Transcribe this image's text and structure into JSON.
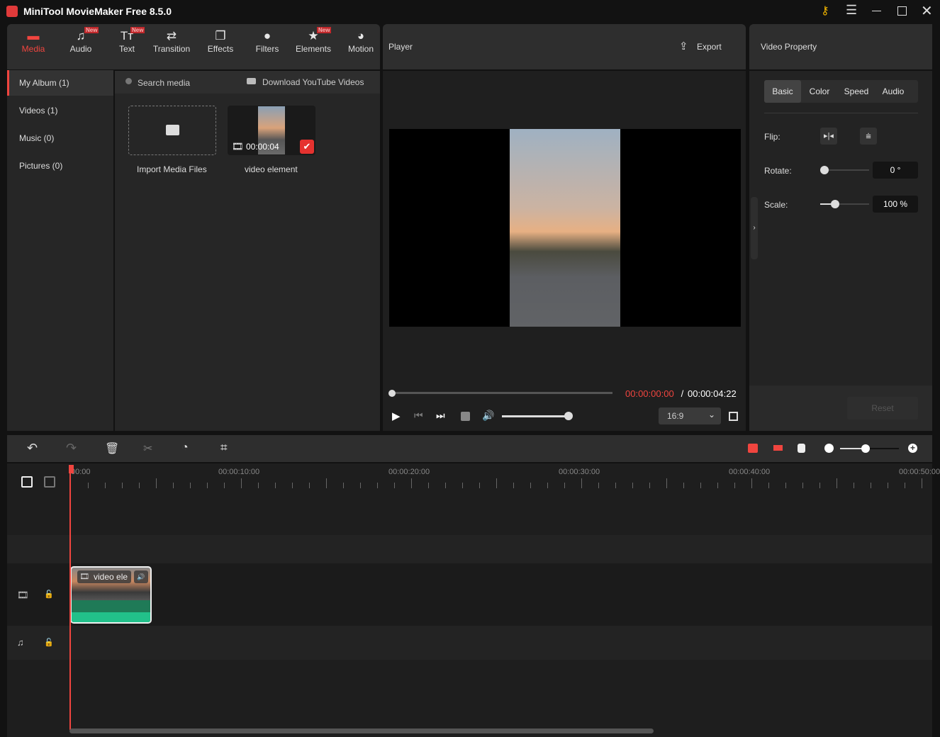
{
  "app": {
    "title": "MiniTool MovieMaker Free 8.5.0"
  },
  "toolbar": {
    "items": [
      {
        "label": "Media",
        "icon": "folder-icon",
        "new": false
      },
      {
        "label": "Audio",
        "icon": "music-icon",
        "new": true
      },
      {
        "label": "Text",
        "icon": "text-icon",
        "new": true
      },
      {
        "label": "Transition",
        "icon": "transition-icon",
        "new": false
      },
      {
        "label": "Effects",
        "icon": "effects-icon",
        "new": false
      },
      {
        "label": "Filters",
        "icon": "filters-icon",
        "new": false
      },
      {
        "label": "Elements",
        "icon": "elements-icon",
        "new": true
      },
      {
        "label": "Motion",
        "icon": "motion-icon",
        "new": false
      }
    ],
    "new_badge": "New"
  },
  "sidebar": {
    "items": [
      "My Album (1)",
      "Videos (1)",
      "Music (0)",
      "Pictures (0)"
    ]
  },
  "media": {
    "search_placeholder": "Search media",
    "download_label": "Download YouTube Videos",
    "import_label": "Import Media Files",
    "clip_name": "video element",
    "clip_duration": "00:00:04"
  },
  "player": {
    "title": "Player",
    "export_label": "Export",
    "current_time": "00:00:00:00",
    "separator": " / ",
    "total_time": "00:00:04:22",
    "aspect": "16:9",
    "progress": 0,
    "volume": 1.0
  },
  "property": {
    "title": "Video Property",
    "tabs": [
      "Basic",
      "Color",
      "Speed",
      "Audio"
    ],
    "flip_label": "Flip:",
    "rotate_label": "Rotate:",
    "rotate_value": "0 °",
    "scale_label": "Scale:",
    "scale_value": "100 %",
    "reset_label": "Reset",
    "rotate_fraction": 0,
    "scale_fraction": 0.25
  },
  "timeline": {
    "ruler_labels": [
      "00:00",
      "00:00:10:00",
      "00:00:20:00",
      "00:00:30:00",
      "00:00:40:00",
      "00:00:50:00"
    ],
    "clip_label": "video ele",
    "zoom_fraction": 0.45
  },
  "colors": {
    "accent": "#f0453f",
    "waveform": "#22c08a"
  }
}
